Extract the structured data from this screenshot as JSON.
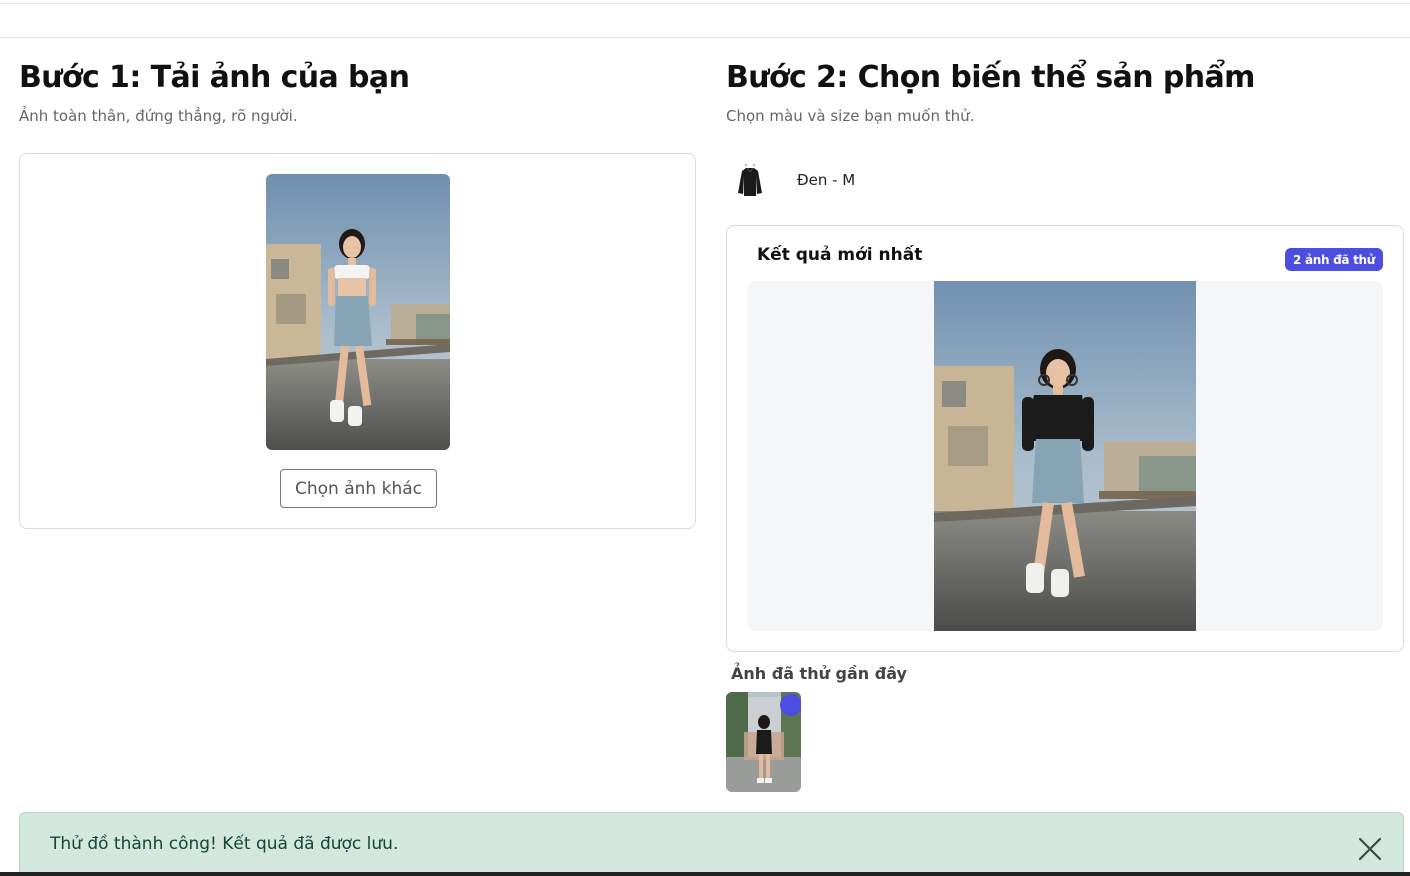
{
  "step1": {
    "title": "Bước 1: Tải ảnh của bạn",
    "description": "Ảnh toàn thân, đứng thẳng, rõ người.",
    "choose_other_label": "Chọn ảnh khác"
  },
  "step2": {
    "title": "Bước 2: Chọn biến thể sản phẩm",
    "description": "Chọn màu và size bạn muốn thử.",
    "variant": {
      "label": "Đen - M",
      "icon": "black-shirt-icon"
    }
  },
  "result": {
    "title": "Kết quả mới nhất",
    "badge": "2 ảnh đã thử"
  },
  "recent": {
    "title": "Ảnh đã thử gần đây"
  },
  "toast": {
    "message": "Thử đồ thành công! Kết quả đã được lưu.",
    "close_icon": "close-icon"
  },
  "colors": {
    "accent": "#4b4ee0",
    "toast_bg": "#d2e7de",
    "toast_text": "#14472e",
    "border": "#dcdcdc"
  }
}
